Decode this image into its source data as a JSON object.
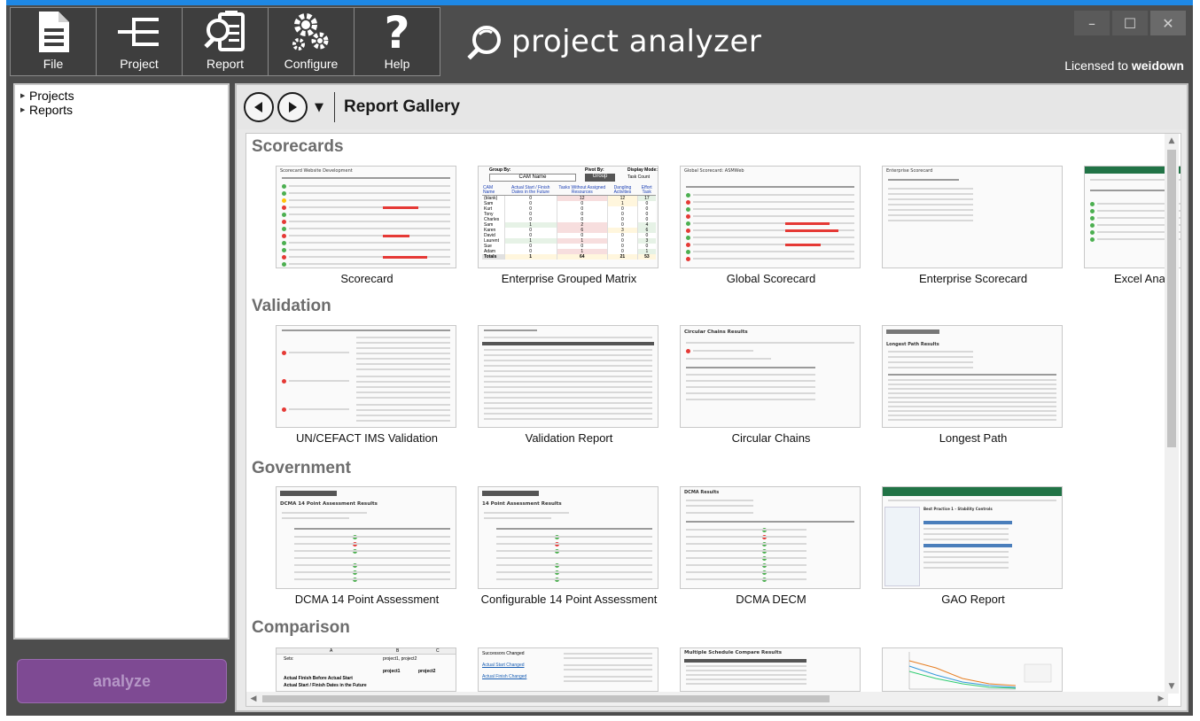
{
  "toolbar": {
    "buttons": [
      {
        "label": "File",
        "icon": "file-icon"
      },
      {
        "label": "Project",
        "icon": "project-tree-icon"
      },
      {
        "label": "Report",
        "icon": "report-magnifier-icon"
      },
      {
        "label": "Configure",
        "icon": "gears-icon"
      },
      {
        "label": "Help",
        "icon": "question-icon"
      }
    ]
  },
  "brand": {
    "name": "project analyzer",
    "icon": "logo-icon"
  },
  "window_controls": {
    "minimize": "–",
    "maximize": "☐",
    "close": "✕"
  },
  "license": {
    "prefix": "Licensed to",
    "user": "weidown"
  },
  "tree": {
    "items": [
      {
        "label": "Projects"
      },
      {
        "label": "Reports"
      }
    ]
  },
  "analyze_label": "analyze",
  "nav": {
    "title": "Report Gallery"
  },
  "gallery": {
    "sections": [
      {
        "title": "Scorecards",
        "cards": [
          "Scorecard",
          "Enterprise Grouped Matrix",
          "Global Scorecard",
          "Enterprise Scorecard",
          "Excel Anal"
        ]
      },
      {
        "title": "Validation",
        "cards": [
          "UN/CEFACT IMS Validation",
          "Validation Report",
          "Circular Chains",
          "Longest Path"
        ]
      },
      {
        "title": "Government",
        "cards": [
          "DCMA 14 Point Assessment",
          "Configurable 14 Point Assessment",
          "DCMA DECM",
          "GAO Report"
        ]
      },
      {
        "title": "Comparison",
        "cards": [
          "",
          "",
          "",
          ""
        ]
      }
    ]
  },
  "thumb_text": {
    "egm_group_by": "Group By:",
    "egm_cam_name": "CAM Name",
    "egm_pivot_by": "Pivot By:",
    "egm_group": "Group",
    "egm_display_mode": "Display Mode:",
    "egm_task_count": "Task Count",
    "egm_headers": [
      "CAM Name",
      "Actual Start / Finish Dates in the Future",
      "Tasks Without Assigned Resources",
      "Dangling Activities",
      "Effort Task"
    ],
    "egm_rows": [
      {
        "name": "(blank)",
        "v": [
          "0",
          "12",
          "12",
          "17"
        ]
      },
      {
        "name": "Sam",
        "v": [
          "0",
          "0",
          "1",
          "0"
        ]
      },
      {
        "name": "Kurt",
        "v": [
          "0",
          "0",
          "0",
          "0"
        ]
      },
      {
        "name": "Tony",
        "v": [
          "0",
          "0",
          "0",
          "0"
        ]
      },
      {
        "name": "Charles",
        "v": [
          "0",
          "0",
          "0",
          "0"
        ]
      },
      {
        "name": "Sam",
        "v": [
          "1",
          "2",
          "0",
          "4"
        ]
      },
      {
        "name": "Karen",
        "v": [
          "0",
          "6",
          "3",
          "6"
        ]
      },
      {
        "name": "David",
        "v": [
          "0",
          "0",
          "0",
          "0"
        ]
      },
      {
        "name": "Laurent",
        "v": [
          "1",
          "1",
          "0",
          "3"
        ]
      },
      {
        "name": "Sue",
        "v": [
          "0",
          "0",
          "0",
          "0"
        ]
      },
      {
        "name": "Adam",
        "v": [
          "0",
          "1",
          "0",
          "1"
        ]
      }
    ],
    "egm_totals": {
      "name": "Totals",
      "v": [
        "1",
        "64",
        "21",
        "53"
      ]
    },
    "sc_title": "Scorecard Website Development",
    "gs_title": "Global Scorecard: ASMWeb",
    "es_title": "Enterprise Scorecard",
    "cc_title": "Circular Chains Results",
    "lp_title": "Longest Path Results",
    "dcma_title": "DCMA 14 Point Assessment Results",
    "c14_title": "14 Point Assessment Results",
    "decm_title": "DCMA Results",
    "gao_title": "Best Practice 1 - Stability Controls",
    "cmp_a": "A",
    "cmp_b": "B",
    "cmp_c": "C",
    "cmp_sets": "Sets:",
    "cmp_projects": "project1, project2",
    "cmp_p1": "project1",
    "cmp_p2": "project2",
    "cmp_row4": "Actual Finish Before Actual Start",
    "cmp_row5": "Actual Start / Finish Dates in the Future",
    "mscr_title": "Multiple Schedule Compare Results",
    "vr_succ": "Successors Changed",
    "vr_actual_start": "Actual Start Changed",
    "vr_actual_finish": "Actual Finish Changed"
  }
}
